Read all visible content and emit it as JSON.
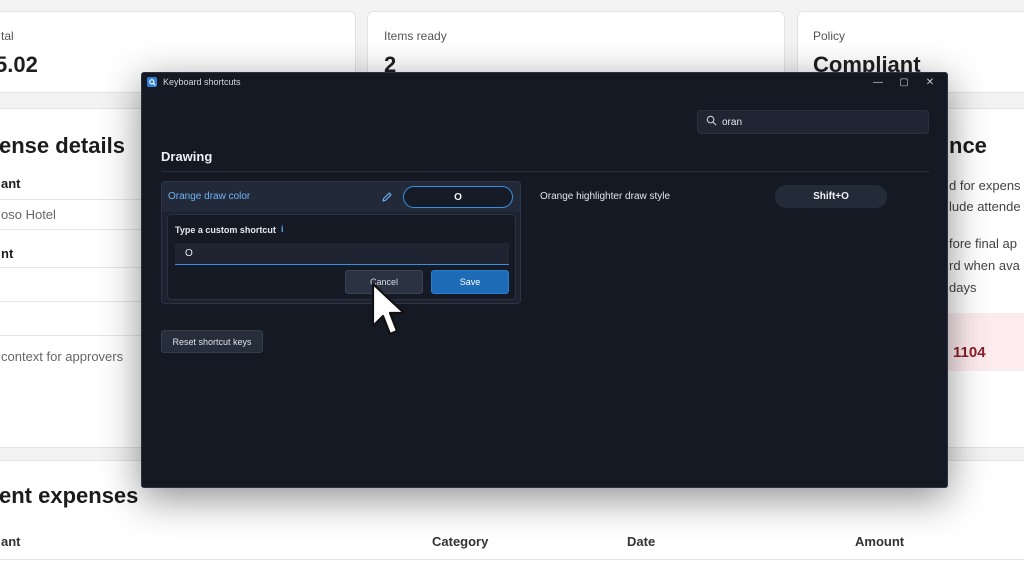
{
  "background": {
    "cards": [
      {
        "label": "tal",
        "value": "5.02"
      },
      {
        "label": "Items ready",
        "value": "2"
      },
      {
        "label": "Policy",
        "value": "Compliant"
      }
    ],
    "left": {
      "heading": "ense details",
      "rows": [
        "ant",
        "oso Hotel",
        "nt",
        "context for approvers"
      ]
    },
    "right": {
      "heading": "nce",
      "lines": [
        "d for expens",
        "lude attende",
        "fore final ap",
        "rd when ava",
        "days"
      ],
      "highlight": "1104"
    },
    "bottom": {
      "heading": "ent expenses",
      "columns": [
        "ant",
        "Category",
        "Date",
        "Amount"
      ]
    }
  },
  "window": {
    "title": "Keyboard shortcuts",
    "controls": {
      "minimize": "—",
      "maximize": "▢",
      "close": "✕"
    },
    "search": {
      "value": "oran",
      "placeholder": ""
    },
    "section_title": "Drawing",
    "shortcut_active": {
      "name": "Orange draw color",
      "key": "O",
      "editor_label": "Type a custom shortcut",
      "editor_info": "i",
      "editor_value": "O",
      "cancel_label": "Cancel",
      "save_label": "Save"
    },
    "shortcut_2": {
      "name": "Orange highlighter draw style",
      "key": "Shift+O"
    },
    "reset_label": "Reset shortcut keys"
  }
}
